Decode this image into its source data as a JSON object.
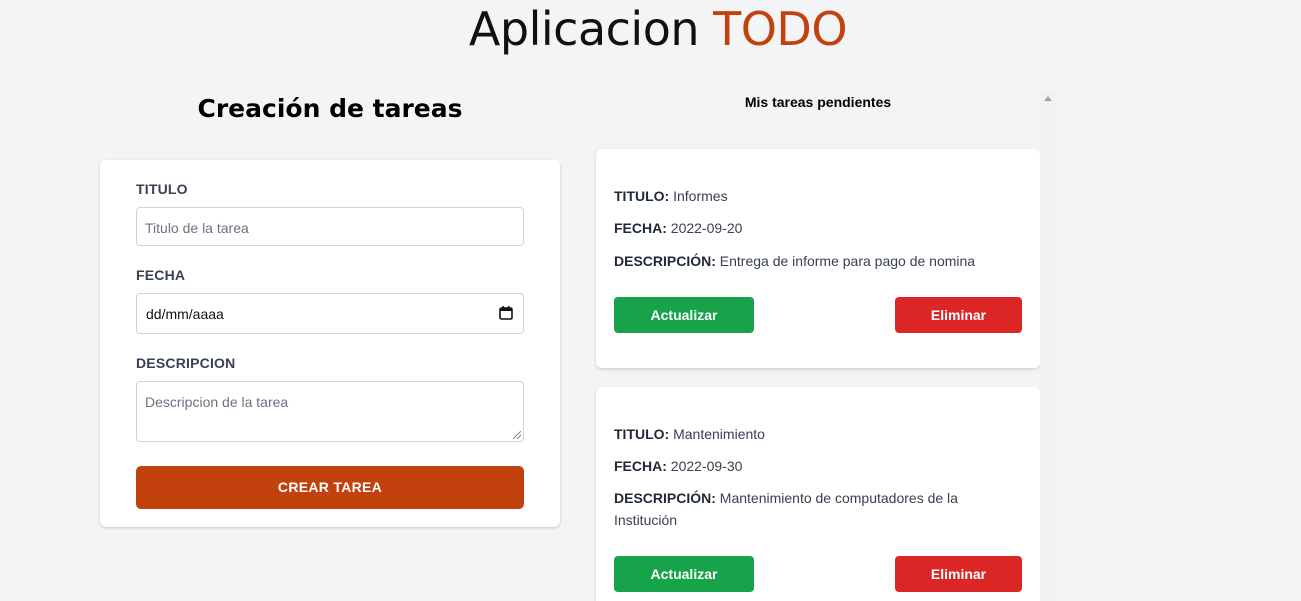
{
  "header": {
    "title_main": "Aplicacion",
    "title_accent": "TODO"
  },
  "form": {
    "heading": "Creación de tareas",
    "title_label": "TITULO",
    "title_placeholder": "Titulo de la tarea",
    "date_label": "FECHA",
    "date_value": "dd/mm/aaaa",
    "desc_label": "DESCRIPCION",
    "desc_placeholder": "Descripcion de la tarea",
    "submit_label": "CREAR TAREA"
  },
  "tasks": {
    "heading": "Mis tareas pendientes",
    "field_titles": {
      "title": "TITULO:",
      "date": "FECHA:",
      "desc": "DESCRIPCIÓN:"
    },
    "update_label": "Actualizar",
    "delete_label": "Eliminar",
    "items": [
      {
        "title": "Informes",
        "date": "2022-09-20",
        "description": "Entrega de informe para pago de nomina"
      },
      {
        "title": "Mantenimiento",
        "date": "2022-09-30",
        "description": "Mantenimiento de computadores de la Institución"
      }
    ]
  },
  "colors": {
    "accent": "#c2410c",
    "update": "#16a34a",
    "delete": "#dc2626"
  }
}
